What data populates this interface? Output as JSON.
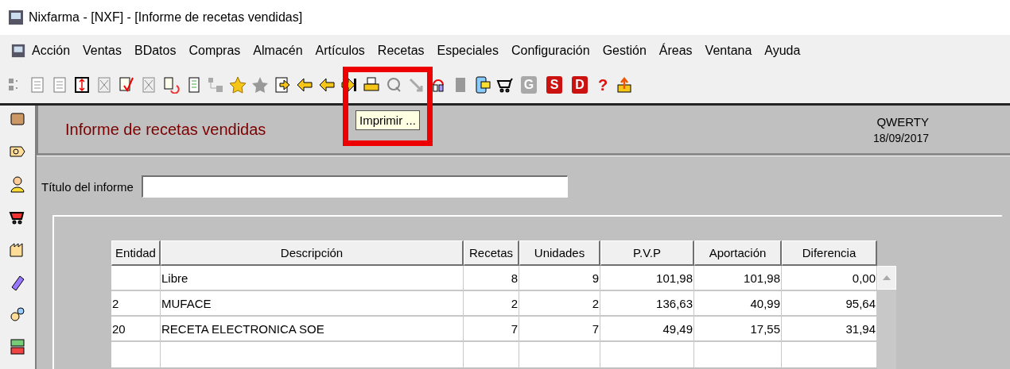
{
  "window": {
    "title": "Nixfarma - [NXF] - [Informe de recetas vendidas]"
  },
  "menu": [
    "Acción",
    "Ventas",
    "BDatos",
    "Compras",
    "Almacén",
    "Artículos",
    "Recetas",
    "Especiales",
    "Configuración",
    "Gestión",
    "Áreas",
    "Ventana",
    "Ayuda"
  ],
  "toolbar": {
    "letter_buttons": [
      {
        "text": "G",
        "color": "#a8a8a8"
      },
      {
        "text": "S",
        "color": "#cc1111"
      },
      {
        "text": "D",
        "color": "#cc1111"
      }
    ],
    "help": "?"
  },
  "tooltip": "Imprimir ...",
  "header": {
    "title": "Informe de recetas vendidas",
    "user": "QWERTY",
    "date": "18/09/2017"
  },
  "form": {
    "label": "Título del informe"
  },
  "table": {
    "columns": [
      "Entidad",
      "Descripción",
      "Recetas",
      "Unidades",
      "P.V.P",
      "Aportación",
      "Diferencia"
    ],
    "rows": [
      [
        "",
        "Libre",
        "8",
        "9",
        "101,98",
        "101,98",
        "0,00"
      ],
      [
        "2",
        "MUFACE",
        "2",
        "2",
        "136,63",
        "40,99",
        "95,64"
      ],
      [
        "20",
        "RECETA ELECTRONICA SOE",
        "7",
        "7",
        "49,49",
        "17,55",
        "31,94"
      ]
    ]
  }
}
